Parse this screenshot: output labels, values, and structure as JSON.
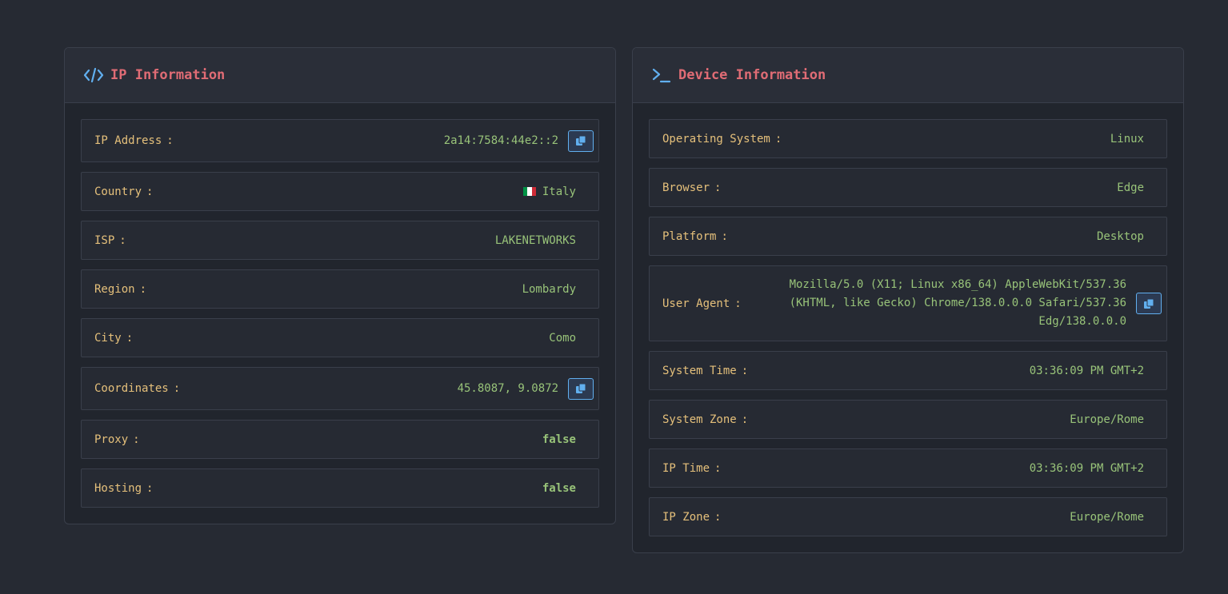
{
  "ip_panel": {
    "title": "IP Information",
    "rows": [
      {
        "label": "IP Address",
        "value": "2a14:7584:44e2::2"
      },
      {
        "label": "Country",
        "value": "Italy"
      },
      {
        "label": "ISP",
        "value": "LAKENETWORKS"
      },
      {
        "label": "Region",
        "value": "Lombardy"
      },
      {
        "label": "City",
        "value": "Como"
      },
      {
        "label": "Coordinates",
        "value": "45.8087, 9.0872"
      },
      {
        "label": "Proxy",
        "value": "false"
      },
      {
        "label": "Hosting",
        "value": "false"
      }
    ],
    "colon": ":"
  },
  "device_panel": {
    "title": "Device Information",
    "rows": [
      {
        "label": "Operating System",
        "value": "Linux"
      },
      {
        "label": "Browser",
        "value": "Edge"
      },
      {
        "label": "Platform",
        "value": "Desktop"
      },
      {
        "label": "User Agent",
        "value": "Mozilla/5.0 (X11; Linux x86_64) AppleWebKit/537.36 (KHTML, like Gecko) Chrome/138.0.0.0 Safari/537.36 Edg/138.0.0.0"
      },
      {
        "label": "System Time",
        "value": "03:36:09 PM GMT+2"
      },
      {
        "label": "System Zone",
        "value": "Europe/Rome"
      },
      {
        "label": "IP Time",
        "value": "03:36:09 PM GMT+2"
      },
      {
        "label": "IP Zone",
        "value": "Europe/Rome"
      }
    ]
  },
  "icons": {
    "ip_header": "code-icon",
    "device_header": "terminal-icon",
    "copy": "copy-icon",
    "flag": "italy-flag-icon"
  },
  "colors": {
    "title": "#e06c75",
    "label": "#e5c07b",
    "value": "#98c379",
    "accent": "#61afef",
    "background": "#262a33"
  }
}
